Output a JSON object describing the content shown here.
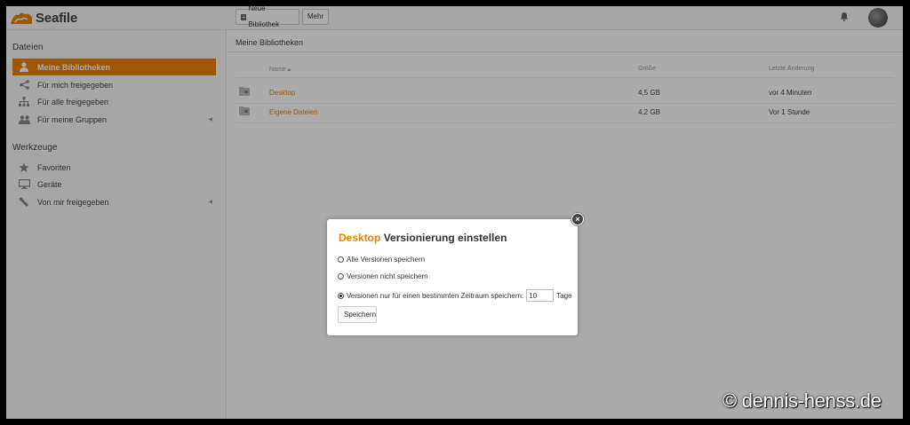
{
  "header": {
    "logo_text": "Seafile",
    "new_library_label": "Neue Bibliothek",
    "more_label": "Mehr"
  },
  "sidebar": {
    "files_heading": "Dateien",
    "files_items": [
      {
        "label": "Meine Bibliotheken",
        "icon": "user-icon",
        "active": true
      },
      {
        "label": "Für mich freigegeben",
        "icon": "share-icon"
      },
      {
        "label": "Für alle freigegeben",
        "icon": "sitemap-icon"
      },
      {
        "label": "Für meine Gruppen",
        "icon": "group-icon"
      }
    ],
    "tools_heading": "Werkzeuge",
    "tools_items": [
      {
        "label": "Favoriten",
        "icon": "star-icon"
      },
      {
        "label": "Geräte",
        "icon": "monitor-icon"
      },
      {
        "label": "Von mir freigegeben",
        "icon": "wrench-icon"
      }
    ]
  },
  "main": {
    "title": "Meine Bibliotheken",
    "columns": {
      "name": "Name ▴",
      "size": "Größe",
      "modified": "Letzte Änderung"
    },
    "rows": [
      {
        "name": "Desktop",
        "size": "4,5 GB",
        "modified": "vor 4 Minuten"
      },
      {
        "name": "Eigene Dateien",
        "size": "4,2 GB",
        "modified": "Vor 1 Stunde"
      }
    ]
  },
  "dialog": {
    "title_library": "Desktop",
    "title_rest": "Versionierung einstellen",
    "options": [
      "Alle Versionen speichern",
      "Versionen nicht speichern",
      "Versionen nur für einen bestimmten Zeitraum speichern:"
    ],
    "selected_option": 3,
    "days_value": "10",
    "days_unit": "Tage",
    "save_label": "Speichern"
  },
  "watermark": "© dennis-henss.de",
  "colors": {
    "accent": "#eb8205"
  }
}
